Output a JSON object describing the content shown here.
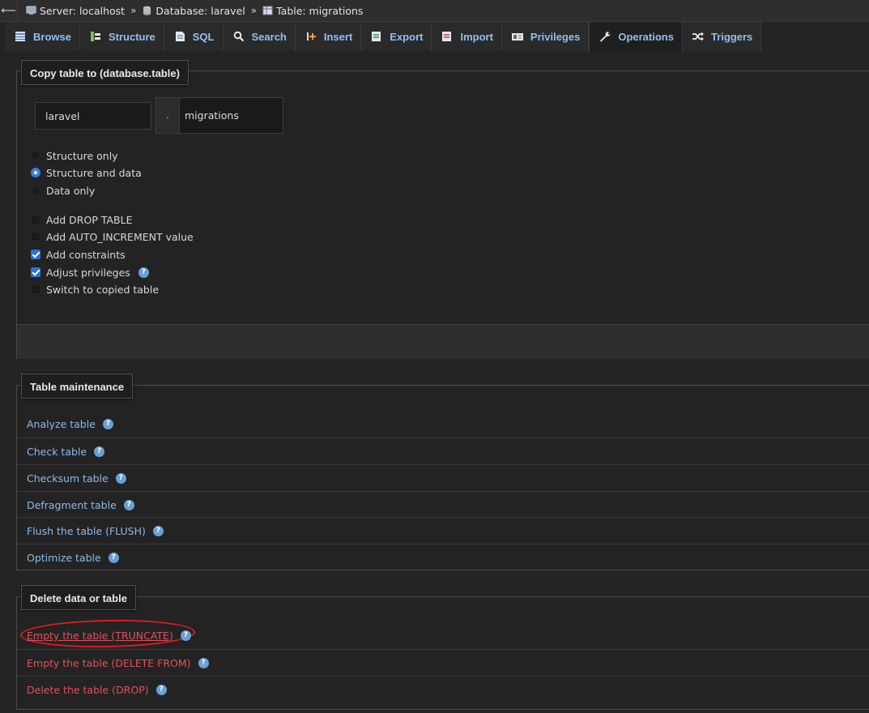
{
  "breadcrumb": {
    "back": "⟵",
    "server": "Server: localhost",
    "database": "Database: laravel",
    "table": "Table: migrations",
    "separator": "»"
  },
  "tabs": [
    {
      "label": "Browse",
      "icon": "browse-icon"
    },
    {
      "label": "Structure",
      "icon": "structure-icon"
    },
    {
      "label": "SQL",
      "icon": "sql-icon"
    },
    {
      "label": "Search",
      "icon": "search-icon"
    },
    {
      "label": "Insert",
      "icon": "insert-icon"
    },
    {
      "label": "Export",
      "icon": "export-icon"
    },
    {
      "label": "Import",
      "icon": "import-icon"
    },
    {
      "label": "Privileges",
      "icon": "privileges-icon"
    },
    {
      "label": "Operations",
      "icon": "wrench-icon",
      "active": true
    },
    {
      "label": "Triggers",
      "icon": "triggers-icon"
    }
  ],
  "copy_table": {
    "title": "Copy table to (database.table)",
    "database_value": "laravel",
    "dot": ".",
    "table_value": "migrations",
    "radios": [
      {
        "label": "Structure only",
        "checked": false
      },
      {
        "label": "Structure and data",
        "checked": true
      },
      {
        "label": "Data only",
        "checked": false
      }
    ],
    "checkboxes": [
      {
        "label": "Add DROP TABLE",
        "checked": false
      },
      {
        "label": "Add AUTO_INCREMENT value",
        "checked": false
      },
      {
        "label": "Add constraints",
        "checked": true
      },
      {
        "label": "Adjust privileges",
        "checked": true,
        "help": true
      },
      {
        "label": "Switch to copied table",
        "checked": false
      }
    ]
  },
  "maintenance": {
    "title": "Table maintenance",
    "links": [
      "Analyze table",
      "Check table",
      "Checksum table",
      "Defragment table",
      "Flush the table (FLUSH)",
      "Optimize table"
    ]
  },
  "delete": {
    "title": "Delete data or table",
    "links": [
      "Empty the table (TRUNCATE)",
      "Empty the table (DELETE FROM)",
      "Delete the table (DROP)"
    ]
  },
  "colors": {
    "link": "#8cbbe8",
    "danger": "#e0505e",
    "annotation": "#e01b24",
    "accent": "#3b7ddd"
  }
}
